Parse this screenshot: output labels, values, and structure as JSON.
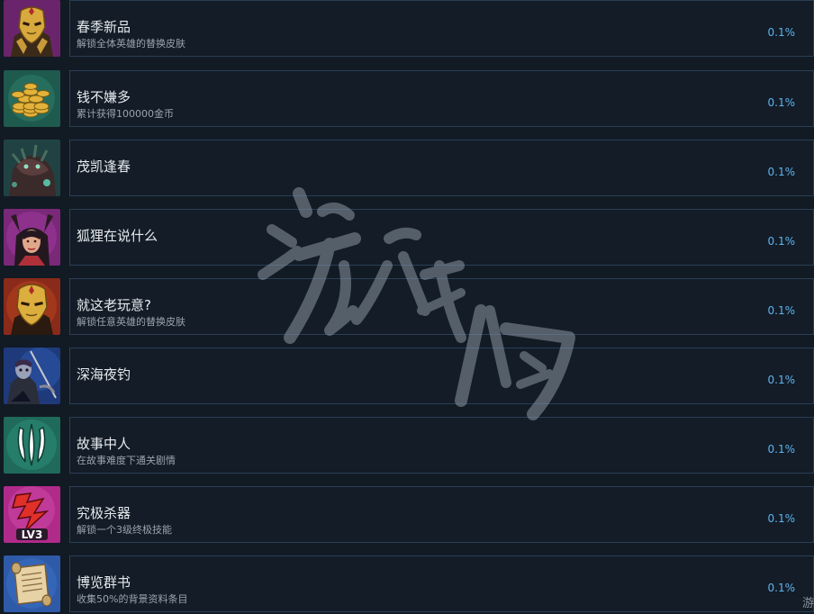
{
  "achievements": [
    {
      "title": "春季新品",
      "desc": "解锁全体英雄的替换皮肤",
      "percent": "0.1%",
      "icon": "golden-mask-icon"
    },
    {
      "title": "钱不嫌多",
      "desc": "累计获得100000金币",
      "percent": "0.1%",
      "icon": "gold-coins-icon"
    },
    {
      "title": "茂凯逢春",
      "desc": "",
      "percent": "0.1%",
      "icon": "tree-monster-icon"
    },
    {
      "title": "狐狸在说什么",
      "desc": "",
      "percent": "0.1%",
      "icon": "fox-girl-icon"
    },
    {
      "title": "就这老玩意?",
      "desc": "解锁任意英雄的替换皮肤",
      "percent": "0.1%",
      "icon": "golden-mask-icon"
    },
    {
      "title": "深海夜钓",
      "desc": "",
      "percent": "0.1%",
      "icon": "undead-fisher-icon"
    },
    {
      "title": "故事中人",
      "desc": "在故事难度下通关剧情",
      "percent": "0.1%",
      "icon": "claw-emblem-icon"
    },
    {
      "title": "究极杀器",
      "desc": "解锁一个3级终极技能",
      "percent": "0.1%",
      "icon": "lv3-ultimate-icon"
    },
    {
      "title": "博览群书",
      "desc": "收集50%的背景资料条目",
      "percent": "0.1%",
      "icon": "scroll-icon"
    }
  ],
  "lv3_text": "LV3",
  "corner_text": "游"
}
